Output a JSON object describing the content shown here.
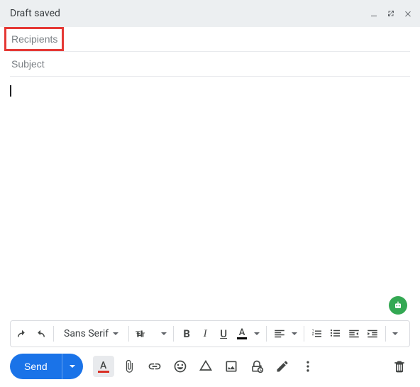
{
  "header": {
    "title": "Draft saved"
  },
  "fields": {
    "recipients_placeholder": "Recipients",
    "recipients_value": "",
    "subject_placeholder": "Subject",
    "subject_value": "",
    "body_value": ""
  },
  "format": {
    "font": "Sans Serif"
  },
  "actions": {
    "send": "Send"
  }
}
